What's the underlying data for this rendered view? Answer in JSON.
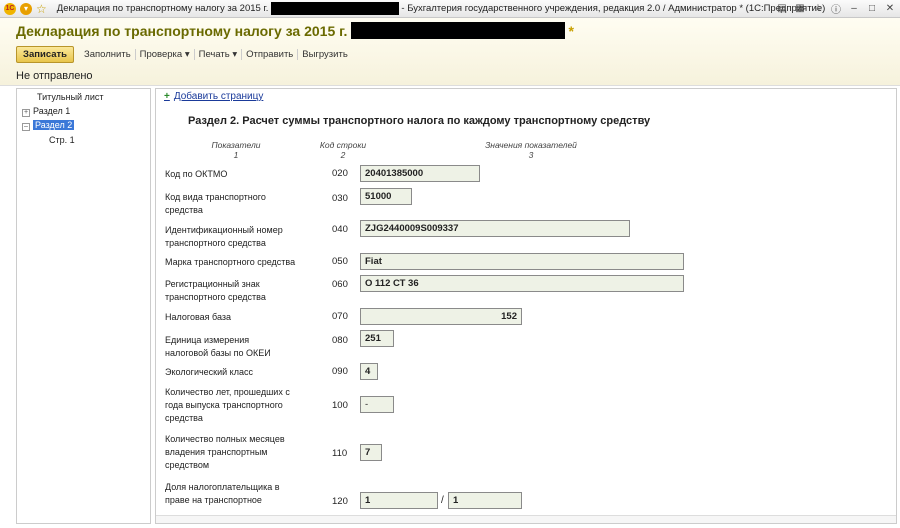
{
  "window": {
    "title_left": "Декларация по транспортному налогу за 2015 г.",
    "title_right": "- Бухгалтерия государственного учреждения, редакция 2.0 / Администратор * (1С:Предприятие)"
  },
  "header": {
    "doc_title": "Декларация по транспортному налогу за 2015 г.",
    "status": "Не отправлено"
  },
  "toolbar": {
    "save": "Записать",
    "fill": "Заполнить",
    "check": "Проверка ▾",
    "print": "Печать ▾",
    "send": "Отправить",
    "export": "Выгрузить"
  },
  "tree": {
    "title_page": "Титульный лист",
    "section1": "Раздел 1",
    "section2": "Раздел 2",
    "page1": "Стр. 1"
  },
  "form": {
    "add_page": "Добавить страницу",
    "section_title": "Раздел 2. Расчет суммы транспортного налога по каждому транспортному средству",
    "col1": "Показатели",
    "col1_num": "1",
    "col2": "Код строки",
    "col2_num": "2",
    "col3": "Значения показателей",
    "col3_num": "3",
    "rows": [
      {
        "label": "Код по ОКТМО",
        "code": "020",
        "value": "20401385000"
      },
      {
        "label": "Код вида транспортного средства",
        "code": "030",
        "value": "51000"
      },
      {
        "label": "Идентификационный номер транспортного средства",
        "code": "040",
        "value": "ZJG2440009S009337"
      },
      {
        "label": "Марка транспортного средства",
        "code": "050",
        "value": "Fiat"
      },
      {
        "label": "Регистрационный знак транспортного средства",
        "code": "060",
        "value": "О 112 СТ 36"
      },
      {
        "label": "Налоговая база",
        "code": "070",
        "value": "152"
      },
      {
        "label": "Единица измерения налоговой базы по ОКЕИ",
        "code": "080",
        "value": "251"
      },
      {
        "label": "Экологический класс",
        "code": "090",
        "value": "4"
      },
      {
        "label": "Количество лет, прошедших с года выпуска транспортного средства",
        "code": "100",
        "value": "-"
      },
      {
        "label": "Количество полных месяцев владения транспортным средством",
        "code": "110",
        "value": "7"
      },
      {
        "label": "Доля налогоплательщика в праве на транспортное",
        "code": "120",
        "value": "1",
        "value2": "1"
      }
    ]
  }
}
